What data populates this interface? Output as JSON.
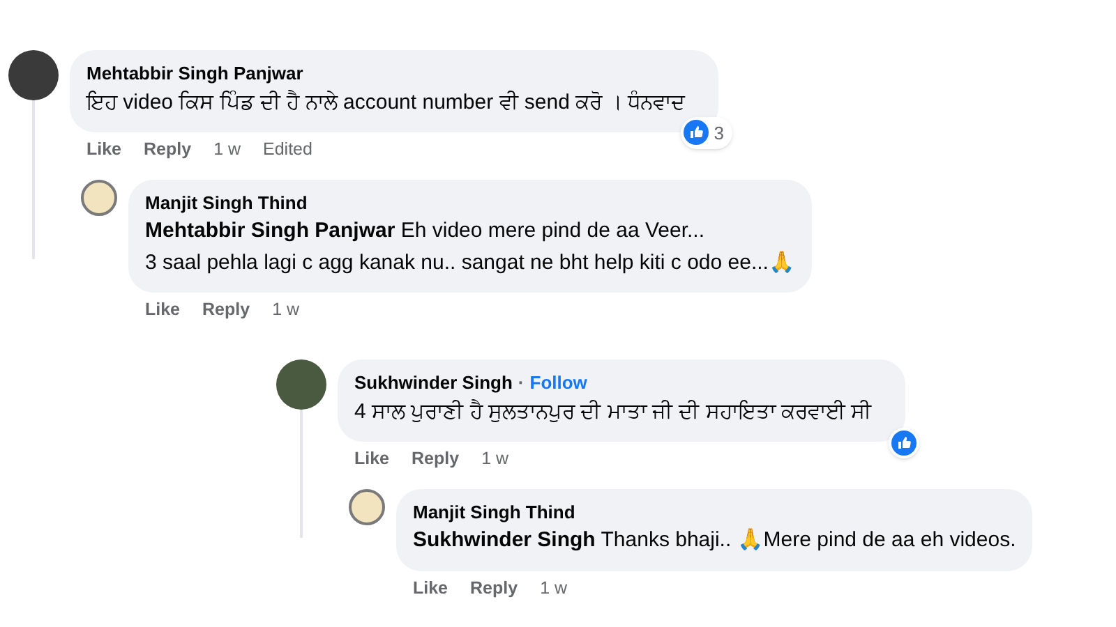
{
  "threads": [
    {
      "comment": {
        "author": "Mehtabbir Singh Panjwar",
        "text": "ਇਹ video ਕਿਸ ਪਿੰਡ ਦੀ ਹੈ ਨਾਲੇ account number ਵੀ send ਕਰੋ । ਧੰਨਵਾਦ",
        "actions": [
          "Like",
          "Reply"
        ],
        "time": "1 w",
        "edited": "Edited",
        "reaction_count": "3"
      },
      "replies": [
        {
          "author": "Manjit Singh Thind",
          "mention": "Mehtabbir Singh Panjwar",
          "lines": [
            "Eh video mere pind de aa Veer...",
            "3 saal pehla lagi c agg kanak nu.. sangat ne bht help kiti c odo ee...🙏"
          ],
          "actions": [
            "Like",
            "Reply"
          ],
          "time": "1 w"
        }
      ]
    },
    {
      "comment": {
        "author": "Sukhwinder Singh",
        "separator": "·",
        "follow": "Follow",
        "text": "4 ਸਾਲ ਪੁਰਾਣੀ ਹੈ ਸੁਲਤਾਨਪੁਰ ਦੀ ਮਾਤਾ ਜੀ ਦੀ ਸਹਾਇਤਾ ਕਰਵਾਈ ਸੀ",
        "actions": [
          "Like",
          "Reply"
        ],
        "time": "1 w"
      },
      "replies": [
        {
          "author": "Manjit Singh Thind",
          "mention": "Sukhwinder Singh",
          "lines": [
            "Thanks bhaji.. 🙏Mere pind de aa eh videos."
          ],
          "actions": [
            "Like",
            "Reply"
          ],
          "time": "1 w"
        }
      ]
    }
  ]
}
